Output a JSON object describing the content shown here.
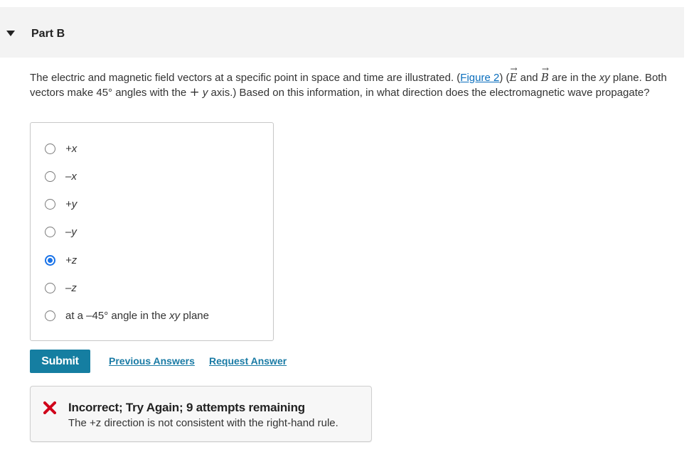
{
  "part": {
    "title": "Part B"
  },
  "question": {
    "text_before_link": "The electric and magnetic field vectors at a specific point in space and time are illustrated. (",
    "link_text": "Figure 2",
    "text_after_link": ") (",
    "e_symbol": "E",
    "and_text": " and ",
    "b_symbol": "B",
    "are_in_text": " are in the ",
    "xy_text": "xy",
    "line2_text": " plane. Both vectors make 45° angles with the ",
    "plus_symbol": "+",
    "y_text": " y",
    "axis_text": " axis.) Based on this information, in what direction does the electromagnetic wave propagate?"
  },
  "choices": [
    {
      "label": "+x",
      "selected": false
    },
    {
      "label": "–x",
      "selected": false
    },
    {
      "label": "+y",
      "selected": false
    },
    {
      "label": "–y",
      "selected": false
    },
    {
      "label": "+z",
      "selected": true
    },
    {
      "label": "–z",
      "selected": false
    },
    {
      "label_prefix": "at a –45° angle in the ",
      "label_italic": "xy",
      "label_suffix": " plane",
      "selected": false
    }
  ],
  "actions": {
    "submit_label": "Submit",
    "previous_answers_label": "Previous Answers",
    "request_answer_label": "Request Answer"
  },
  "feedback": {
    "icon": "x-mark-icon",
    "title": "Incorrect; Try Again; 9 attempts remaining",
    "message": "The +z direction is not consistent with the right-hand rule.",
    "icon_color": "#d0021b"
  },
  "colors": {
    "accent": "#157ea1",
    "radio_selected": "#1a73e8",
    "link": "#0a6ebd"
  }
}
